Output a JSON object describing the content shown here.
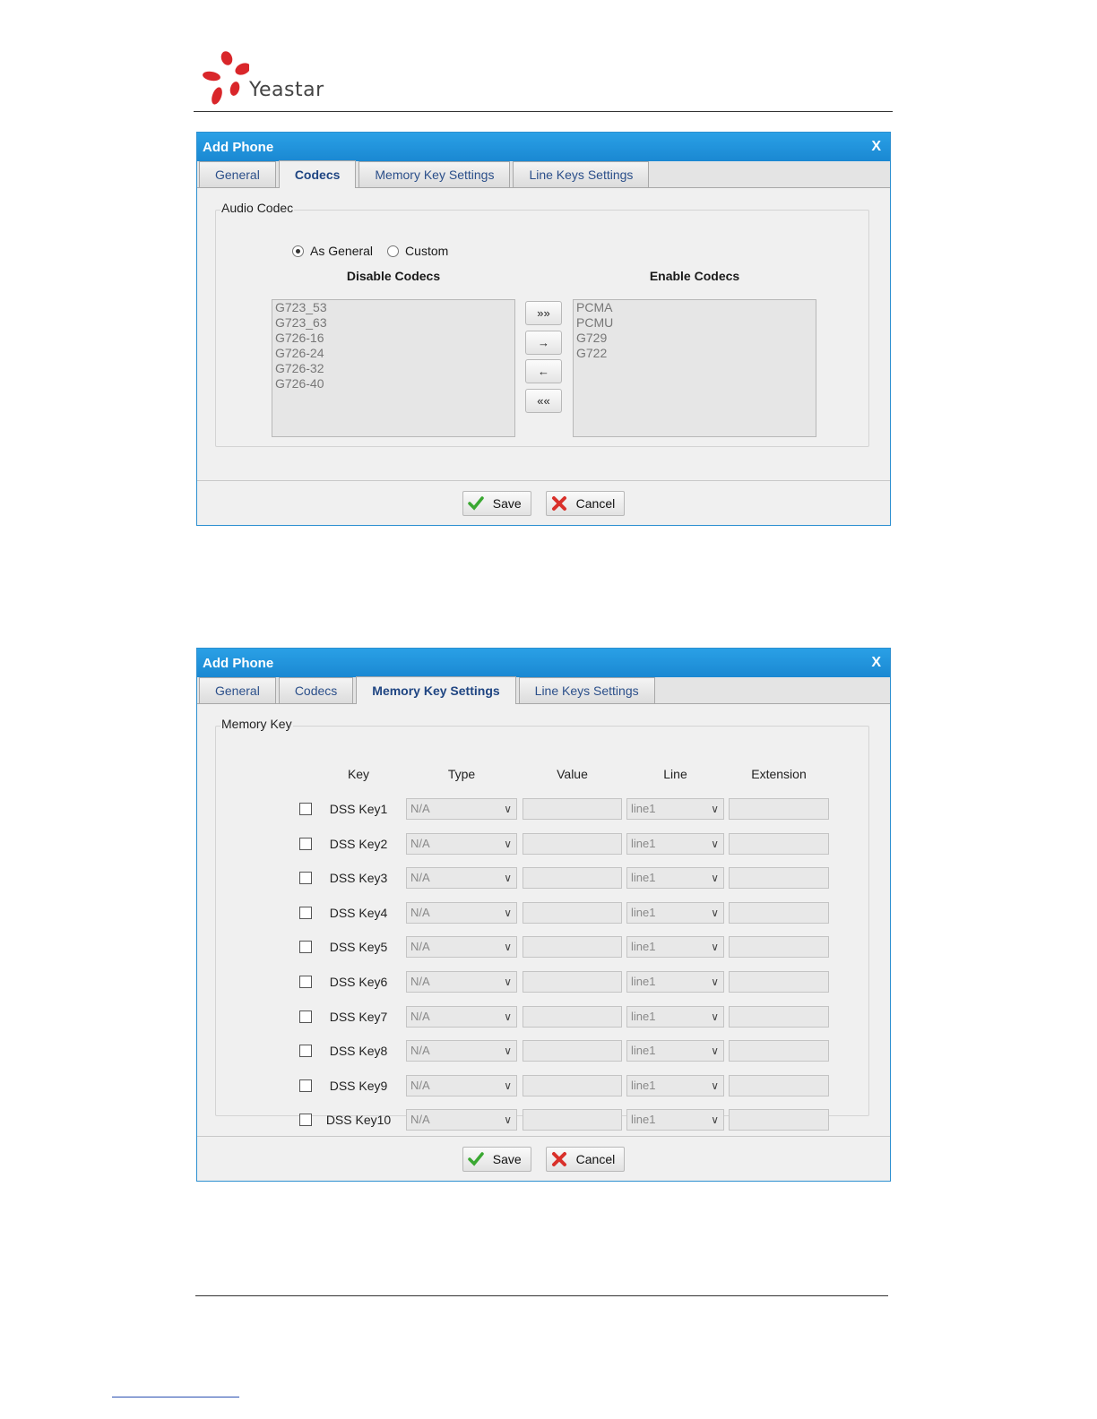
{
  "brand": {
    "name": "Yeastar",
    "logo_color": "#d9262a"
  },
  "dialog_codecs": {
    "title": "Add Phone",
    "close_label": "X",
    "tabs": [
      "General",
      "Codecs",
      "Memory Key Settings",
      "Line Keys Settings"
    ],
    "active_tab": "Codecs",
    "section_legend": "Audio Codec",
    "radio_options": [
      {
        "label": "As General",
        "selected": true
      },
      {
        "label": "Custom",
        "selected": false
      }
    ],
    "disable_heading": "Disable Codecs",
    "enable_heading": "Enable Codecs",
    "disabled_codecs": [
      "G723_53",
      "G723_63",
      "G726-16",
      "G726-24",
      "G726-32",
      "G726-40"
    ],
    "enabled_codecs": [
      "PCMA",
      "PCMU",
      "G729",
      "G722"
    ],
    "move_buttons": [
      {
        "label": "»»",
        "icon": "double-right-arrow-icon"
      },
      {
        "label": "→",
        "icon": "right-arrow-icon"
      },
      {
        "label": "←",
        "icon": "left-arrow-icon"
      },
      {
        "label": "««",
        "icon": "double-left-arrow-icon"
      }
    ],
    "save_label": "Save",
    "cancel_label": "Cancel"
  },
  "dialog_memory": {
    "title": "Add Phone",
    "close_label": "X",
    "tabs": [
      "General",
      "Codecs",
      "Memory Key Settings",
      "Line Keys Settings"
    ],
    "active_tab": "Memory Key Settings",
    "section_legend": "Memory Key",
    "columns": {
      "key": "Key",
      "type": "Type",
      "value": "Value",
      "line": "Line",
      "extension": "Extension"
    },
    "rows": [
      {
        "key": "DSS Key1",
        "type": "N/A",
        "value": "",
        "line": "line1",
        "extension": ""
      },
      {
        "key": "DSS Key2",
        "type": "N/A",
        "value": "",
        "line": "line1",
        "extension": ""
      },
      {
        "key": "DSS Key3",
        "type": "N/A",
        "value": "",
        "line": "line1",
        "extension": ""
      },
      {
        "key": "DSS Key4",
        "type": "N/A",
        "value": "",
        "line": "line1",
        "extension": ""
      },
      {
        "key": "DSS Key5",
        "type": "N/A",
        "value": "",
        "line": "line1",
        "extension": ""
      },
      {
        "key": "DSS Key6",
        "type": "N/A",
        "value": "",
        "line": "line1",
        "extension": ""
      },
      {
        "key": "DSS Key7",
        "type": "N/A",
        "value": "",
        "line": "line1",
        "extension": ""
      },
      {
        "key": "DSS Key8",
        "type": "N/A",
        "value": "",
        "line": "line1",
        "extension": ""
      },
      {
        "key": "DSS Key9",
        "type": "N/A",
        "value": "",
        "line": "line1",
        "extension": ""
      },
      {
        "key": "DSS Key10",
        "type": "N/A",
        "value": "",
        "line": "line1",
        "extension": ""
      }
    ],
    "save_label": "Save",
    "cancel_label": "Cancel"
  },
  "colors": {
    "title_bar": "#1a88d2",
    "save_check": "#3aa832",
    "cancel_x": "#d9302a"
  }
}
